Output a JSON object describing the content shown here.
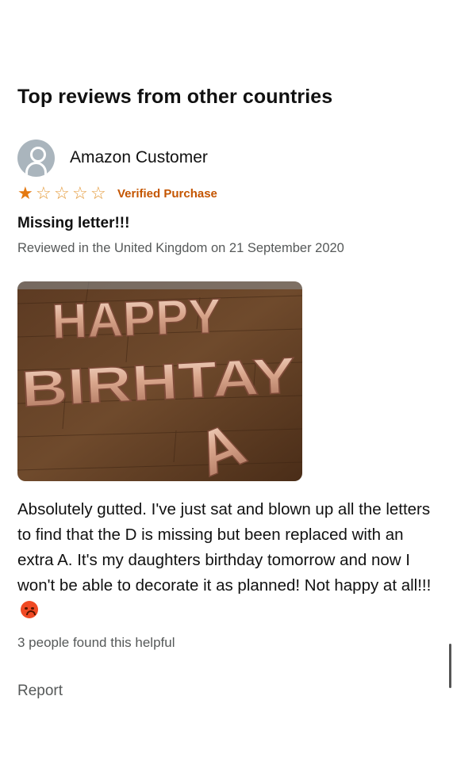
{
  "section": {
    "title": "Top reviews from other countries"
  },
  "review": {
    "reviewer_name": "Amazon Customer",
    "avatar_icon": "person-icon",
    "rating": 1,
    "rating_max": 5,
    "star_color": "#e47911",
    "verified_label": "Verified Purchase",
    "title": "Missing letter!!!",
    "meta": "Reviewed in the United Kingdom on 21 September 2020",
    "photo": {
      "line1": "HAPPY",
      "line2": "BIRHTAY",
      "line3": "A"
    },
    "body": "Absolutely gutted. I've just sat and blown up all the letters to find that the D is missing but been replaced with an extra A. It's my daughters birthday tomorrow and now I won't be able to decorate it as planned! Not happy at all!!!",
    "body_emoji": "angry-face-icon",
    "helpful_text": "3 people found this helpful",
    "report_label": "Report"
  }
}
